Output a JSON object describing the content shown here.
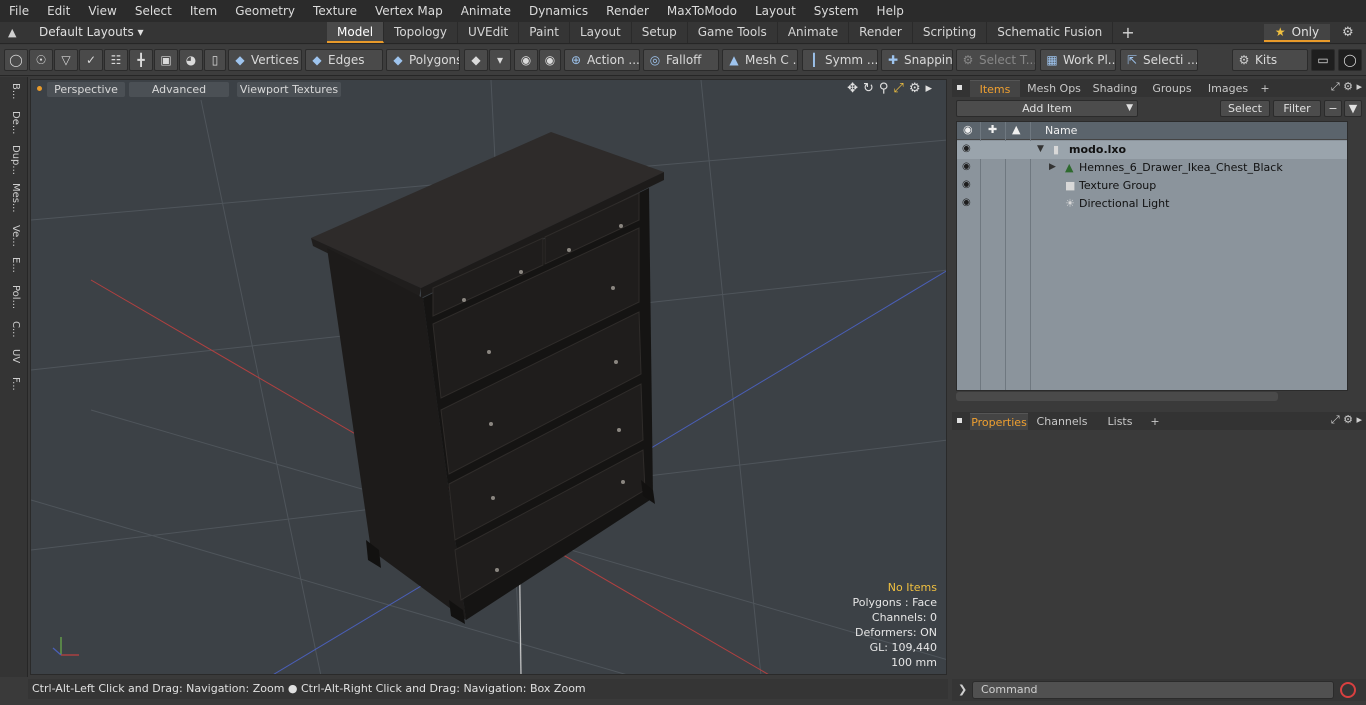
{
  "menu": [
    "File",
    "Edit",
    "View",
    "Select",
    "Item",
    "Geometry",
    "Texture",
    "Vertex Map",
    "Animate",
    "Dynamics",
    "Render",
    "MaxToModo",
    "Layout",
    "System",
    "Help"
  ],
  "layout": {
    "default_layouts": "Default Layouts ▾",
    "tabs": [
      "Model",
      "Topology",
      "UVEdit",
      "Paint",
      "Layout",
      "Setup",
      "Game Tools",
      "Animate",
      "Render",
      "Scripting",
      "Schematic Fusion"
    ],
    "active_tab": "Model",
    "plus": "+",
    "only_label": "Only"
  },
  "toolbar": {
    "vertices": "Vertices",
    "edges": "Edges",
    "polygons": "Polygons",
    "action": "Action ...",
    "falloff": "Falloff",
    "mesh": "Mesh C ...",
    "symm": "Symm ...",
    "snapping": "Snapping",
    "select_t": "Select T...",
    "work_pl": "Work Pl...",
    "selecti": "Selecti ...",
    "kits": "Kits"
  },
  "left_tabs": [
    "B...",
    "De...",
    "Dup...",
    "Mes...",
    "Ve...",
    "E...",
    "Pol...",
    "C...",
    "UV",
    "F..."
  ],
  "viewport": {
    "perspective": "Perspective",
    "advanced": "Advanced",
    "viewport_textures": "Viewport Textures",
    "info": {
      "no_items": "No Items",
      "polygons": "Polygons : Face",
      "channels": "Channels: 0",
      "deformers": "Deformers: ON",
      "gl": "GL: 109,440",
      "scale": "100 mm"
    }
  },
  "status": "Ctrl-Alt-Left Click and Drag: Navigation: Zoom ● Ctrl-Alt-Right Click and Drag: Navigation: Box Zoom",
  "items_panel": {
    "tabs": [
      "Items",
      "Mesh Ops",
      "Shading",
      "Groups",
      "Images"
    ],
    "active_tab": "Items",
    "add_item": "Add Item",
    "select": "Select",
    "filter": "Filter",
    "column_name": "Name",
    "rows": [
      {
        "label": "modo.lxo",
        "bold": true
      },
      {
        "label": "Hemnes_6_Drawer_Ikea_Chest_Black",
        "bold": false
      },
      {
        "label": "Texture Group",
        "bold": false
      },
      {
        "label": "Directional Light",
        "bold": false
      }
    ]
  },
  "properties_panel": {
    "tabs": [
      "Properties",
      "Channels",
      "Lists"
    ],
    "active_tab": "Properties"
  },
  "command": {
    "placeholder": "Command"
  }
}
